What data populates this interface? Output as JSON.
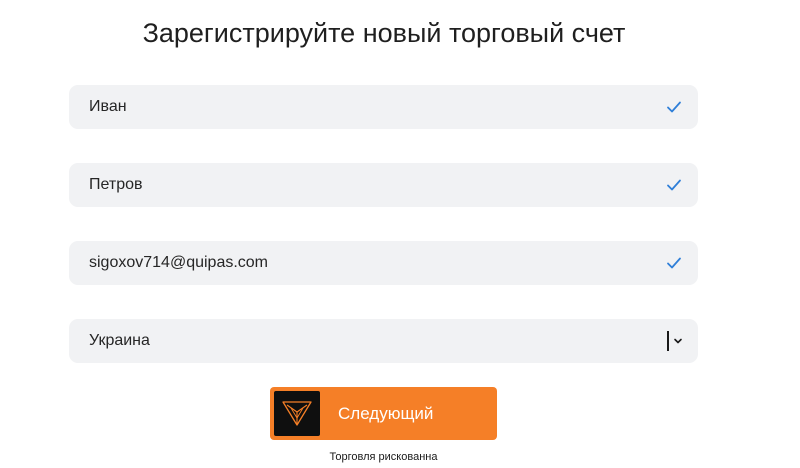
{
  "page": {
    "title": "Зарегистрируйте новый торговый счет"
  },
  "form": {
    "first_name": {
      "value": "Иван",
      "valid": true
    },
    "last_name": {
      "value": "Петров",
      "valid": true
    },
    "email": {
      "value": "sigoxov714@quipas.com",
      "valid": true
    },
    "country": {
      "selected": "Украина"
    }
  },
  "submit": {
    "label": "Следующий",
    "logo_icon": "trading-logo-icon"
  },
  "footer": {
    "risk_note": "Торговля рискованна"
  },
  "colors": {
    "accent": "#f57f27",
    "check": "#2f7fd8",
    "field_bg": "#f1f2f4",
    "logo_bg": "#0f0f0f"
  }
}
